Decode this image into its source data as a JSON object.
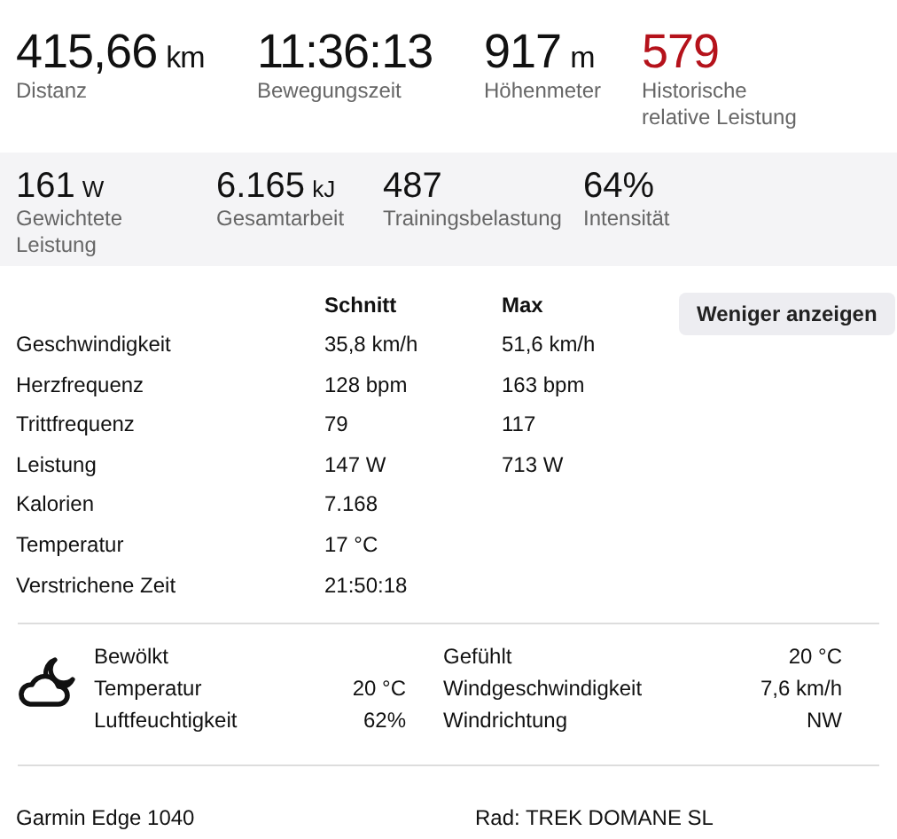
{
  "primary_stats": [
    {
      "value": "415,66",
      "unit": "km",
      "label": "Distanz",
      "kind": "normal"
    },
    {
      "value": "11:36:13",
      "label": "Bewegungszeit",
      "kind": "normal"
    },
    {
      "value": "917",
      "unit": "m",
      "label": "Höhenmeter",
      "kind": "normal"
    },
    {
      "value": "579",
      "label": "Historische relative Leistung",
      "kind": "highlight"
    }
  ],
  "secondary_stats": [
    {
      "value": "161",
      "unit": "W",
      "label": "Gewichtete Leistung"
    },
    {
      "value": "6.165",
      "unit": "kJ",
      "label": "Gesamtarbeit"
    },
    {
      "value": "487",
      "label": "Trainingsbelastung"
    },
    {
      "value": "64%",
      "label": "Intensität"
    }
  ],
  "details": {
    "columns": [
      "Schnitt",
      "Max"
    ],
    "button": "Weniger anzeigen",
    "rows": [
      {
        "label": "Geschwindigkeit",
        "avg": "35,8 km/h",
        "max": "51,6 km/h"
      },
      {
        "label": "Herzfrequenz",
        "avg": "128 bpm",
        "max": "163 bpm"
      },
      {
        "label": "Trittfrequenz",
        "avg": "79",
        "max": "117"
      },
      {
        "label": "Leistung",
        "avg": "147 W",
        "max": "713 W"
      },
      {
        "label": "Kalorien",
        "avg": "7.168"
      },
      {
        "label": "Temperatur",
        "avg": "17 °C"
      },
      {
        "label": "Verstrichene Zeit",
        "avg": "21:50:18"
      }
    ]
  },
  "weather": {
    "left": [
      {
        "label": "Bewölkt"
      },
      {
        "label": "Temperatur",
        "value": "20 °C"
      },
      {
        "label": "Luftfeuchtigkeit",
        "value": "62%"
      }
    ],
    "right": [
      {
        "label": "Gefühlt",
        "value": "20 °C"
      },
      {
        "label": "Windgeschwindigkeit",
        "value": "7,6 km/h"
      },
      {
        "label": "Windrichtung",
        "value": "NW"
      }
    ]
  },
  "footer": {
    "device": "Garmin Edge 1040",
    "bike": "Rad: TREK DOMANE SL"
  }
}
